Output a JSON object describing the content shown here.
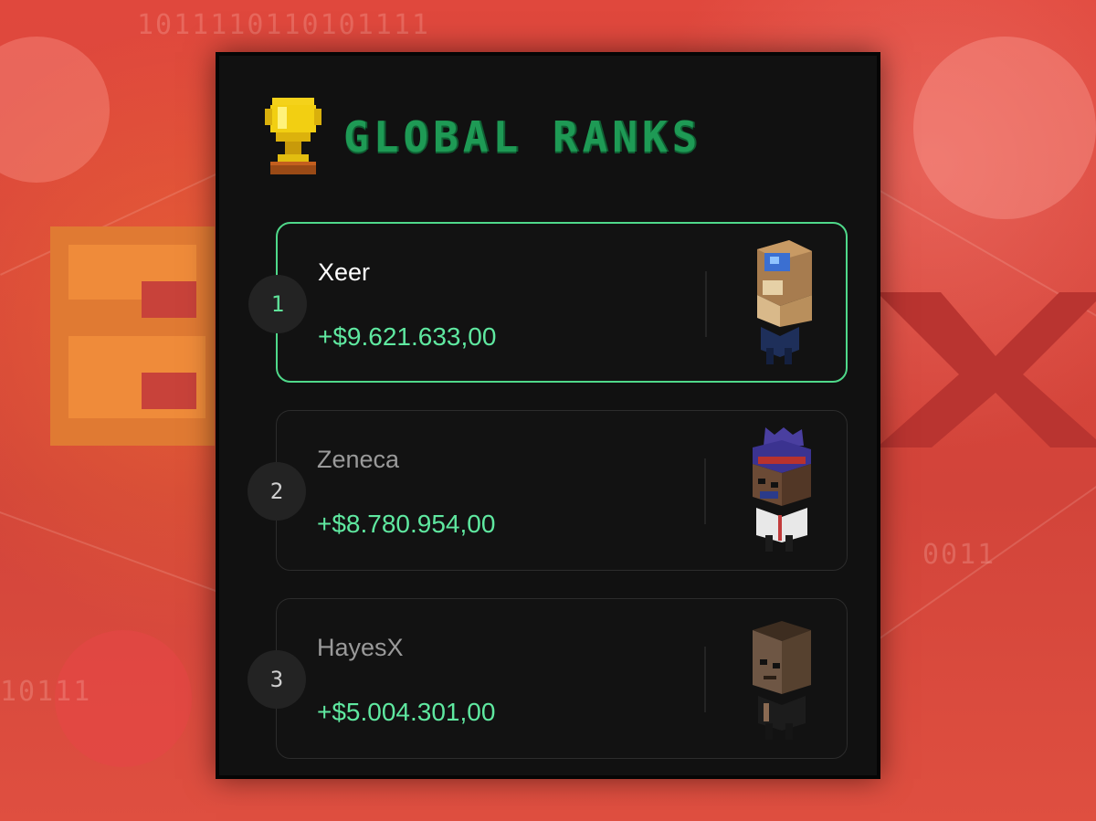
{
  "header": {
    "title": "GLOBAL RANKS"
  },
  "background": {
    "binary_top": "1011110110101111",
    "binary_left": "10111",
    "binary_right": "0011"
  },
  "ranks": [
    {
      "position": "1",
      "name": "Xeer",
      "amount": "+$9.621.633,00",
      "highlighted": true
    },
    {
      "position": "2",
      "name": "Zeneca",
      "amount": "+$8.780.954,00",
      "highlighted": false
    },
    {
      "position": "3",
      "name": "HayesX",
      "amount": "+$5.004.301,00",
      "highlighted": false
    }
  ],
  "colors": {
    "accent": "#5fe8a0",
    "title": "#1e9a55",
    "panel": "#111111",
    "background": "#d9473c"
  },
  "icons": {
    "trophy": "trophy-icon"
  }
}
